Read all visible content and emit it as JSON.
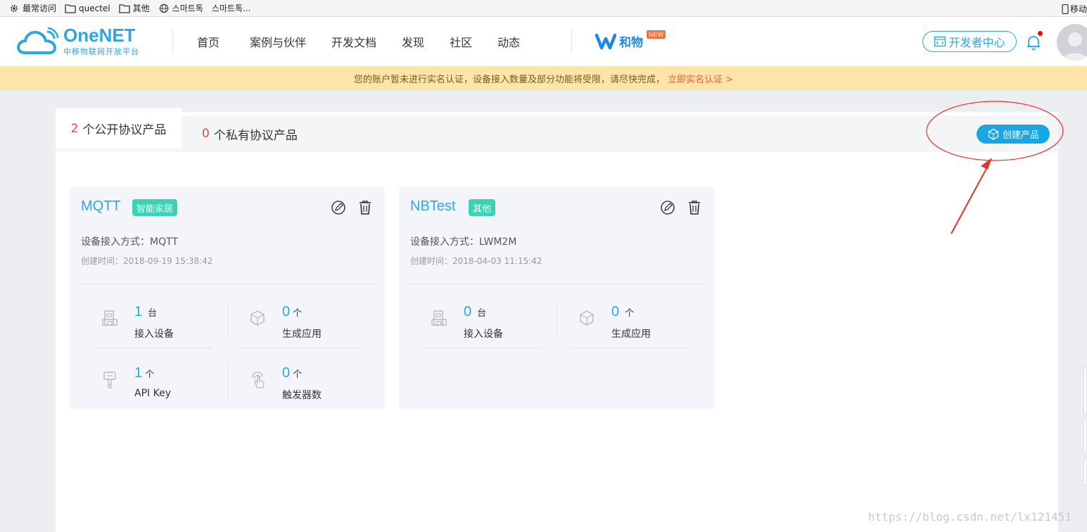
{
  "bookmarks": {
    "items": [
      "最常访问",
      "quectel",
      "其他",
      "스마트톡",
      "스마트톡..."
    ],
    "right_label": "移动"
  },
  "header": {
    "logo_name": "OneNET",
    "logo_sub": "中移物联网开放平台",
    "nav": [
      "首页",
      "案例与伙伴",
      "开发文档",
      "发现",
      "社区",
      "动态"
    ],
    "hewu": "和物",
    "new_badge": "NEW",
    "dev_center": "开发者中心"
  },
  "notice": {
    "text": "您的账户暂未进行实名认证，设备接入数量及部分功能将受限，请尽快完成，",
    "link": "立即实名认证 >"
  },
  "tabs": [
    {
      "count": "2",
      "label": "个公开协议产品"
    },
    {
      "count": "0",
      "label": "个私有协议产品"
    }
  ],
  "create_button": "创建产品",
  "products": [
    {
      "name": "MQTT",
      "tag": "智能家居",
      "method": "设备接入方式：MQTT",
      "created": "创建时间：2018-09-19 15:38:42",
      "stats": [
        {
          "value": "1",
          "unit": "台",
          "label": "接入设备",
          "icon": "device-icon"
        },
        {
          "value": "0",
          "unit": "个",
          "label": "生成应用",
          "icon": "cube-icon"
        },
        {
          "value": "1",
          "unit": "个",
          "label": "API Key",
          "icon": "key-icon"
        },
        {
          "value": "0",
          "unit": "个",
          "label": "触发器数",
          "icon": "touch-icon"
        }
      ]
    },
    {
      "name": "NBTest",
      "tag": "其他",
      "method": "设备接入方式：LWM2M",
      "created": "创建时间：2018-04-03 11:15:42",
      "stats": [
        {
          "value": "0",
          "unit": "台",
          "label": "接入设备",
          "icon": "device-icon"
        },
        {
          "value": "0",
          "unit": "个",
          "label": "生成应用",
          "icon": "cube-icon"
        }
      ]
    }
  ],
  "watermark": "https://blog.csdn.net/lx121451",
  "colors": {
    "accent": "#2aa7e0",
    "tag": "#3cd3b4",
    "notice_bg": "#fde4a8",
    "annotation": "#e8302a"
  }
}
